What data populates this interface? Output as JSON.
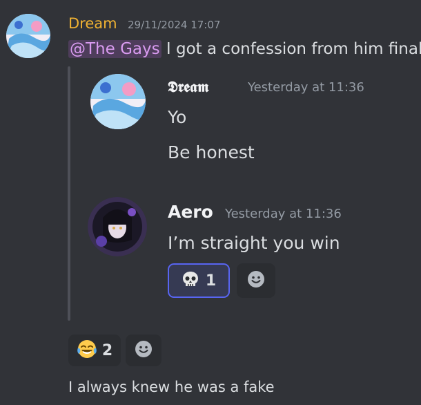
{
  "outer_message": {
    "author": "Dream",
    "author_color": "#f0b232",
    "timestamp": "29/11/2024 17:07",
    "role_mention": "@The Gays",
    "text": " I got a confession from him finally"
  },
  "forwarded": [
    {
      "author": "𝕯𝖗𝖊𝖆𝖒",
      "timestamp": "Yesterday at 11:36",
      "lines": [
        "Yo",
        "Be honest"
      ]
    },
    {
      "author": "Aero",
      "timestamp": "Yesterday at 11:36",
      "lines": [
        "I’m straight you win"
      ],
      "reaction": {
        "emoji": "skull",
        "count": "1"
      }
    }
  ],
  "outer_reaction": {
    "emoji": "joy",
    "count": "2"
  },
  "follow_up": {
    "text": "I always knew he was a fake"
  },
  "colors": {
    "background": "#313338",
    "accent": "#5865f2",
    "muted": "#949ba4"
  }
}
